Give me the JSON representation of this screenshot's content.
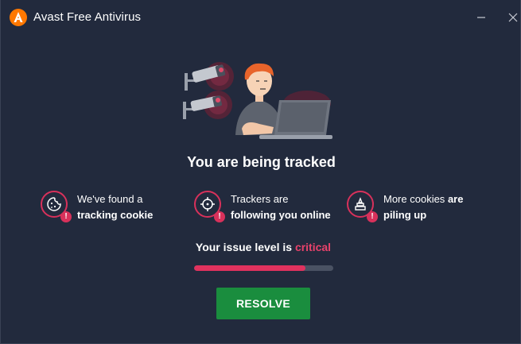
{
  "window": {
    "title": "Avast Free Antivirus"
  },
  "main": {
    "headline": "You are being tracked",
    "issues": [
      {
        "line1": "We've found a",
        "line2_bold": "tracking cookie",
        "icon": "cookie-icon"
      },
      {
        "line1": "Trackers are",
        "line2_bold": "following you online",
        "icon": "crosshair-icon"
      },
      {
        "line1_normal": "More cookies",
        "line1_bold": "are",
        "line2_bold": "piling up",
        "icon": "cookie-pile-icon"
      }
    ],
    "issue_badge": "!",
    "issue_level_prefix": "Your issue level is",
    "issue_level_value": "critical",
    "issue_level_fraction": 0.8,
    "resolve_label": "RESOLVE"
  },
  "colors": {
    "background": "#222a3d",
    "accent_critical": "#e0325e",
    "resolve_button": "#1a8d3e",
    "logo_orange": "#ff7800"
  }
}
